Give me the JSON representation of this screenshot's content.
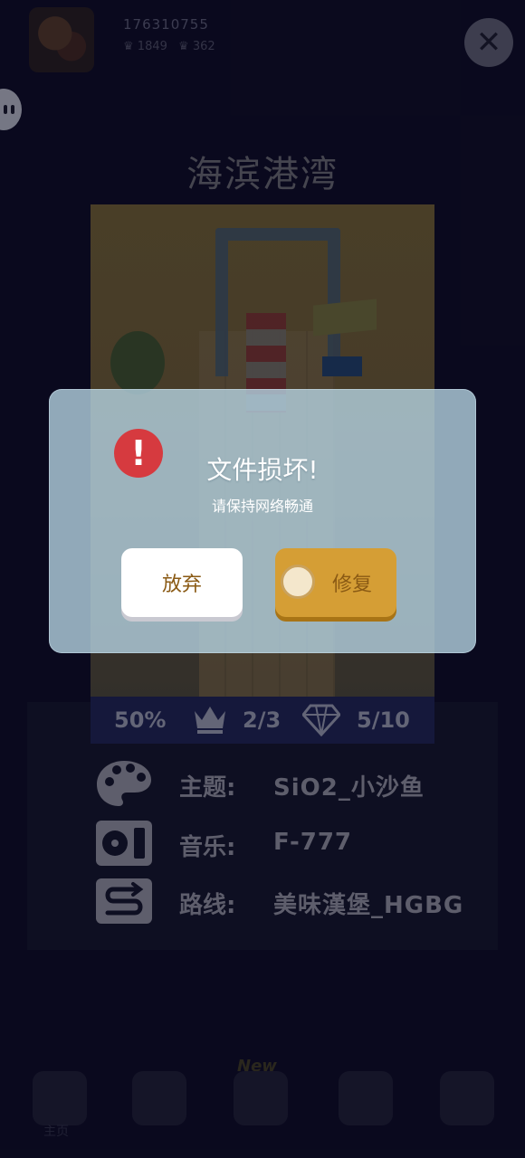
{
  "header": {
    "user_id": "176310755",
    "stat_a": "1849",
    "stat_b": "362"
  },
  "level": {
    "title": "海滨港湾",
    "progress": "50%",
    "crowns": "2/3",
    "gems": "5/10"
  },
  "info": {
    "rows": [
      {
        "label": "主题:",
        "value": "SiO2_小沙鱼",
        "icon": "palette-icon"
      },
      {
        "label": "音乐:",
        "value": "F-777",
        "icon": "music-player-icon"
      },
      {
        "label": "路线:",
        "value": "美味漢堡_HGBG",
        "icon": "route-icon"
      }
    ]
  },
  "nav": {
    "home_label": "主页",
    "new_badge": "New"
  },
  "dialog": {
    "title": "文件损坏!",
    "message": "请保持网络畅通",
    "cancel_label": "放弃",
    "confirm_label": "修复"
  },
  "colors": {
    "background": "#0d0c24",
    "warning": "#d63a3f",
    "confirm": "#d59e35",
    "button_text": "#8a5a14"
  }
}
